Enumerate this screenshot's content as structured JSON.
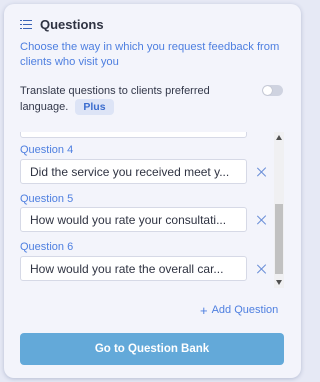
{
  "panel": {
    "title": "Questions",
    "subtitle": "Choose the way in which you request feedback from clients who visit you"
  },
  "translate": {
    "label_line1": "Translate questions to clients preferred",
    "label_line2": "language.",
    "badge": "Plus",
    "enabled": false
  },
  "questions": [
    {
      "label": "Question 4",
      "value": "Did the service you received meet y..."
    },
    {
      "label": "Question 5",
      "value": "How would you rate your consultati..."
    },
    {
      "label": "Question 6",
      "value": "How would you rate the overall car..."
    }
  ],
  "actions": {
    "add_question": "Add Question",
    "go_to_bank": "Go to Question Bank"
  },
  "colors": {
    "accent": "#4e7fe0",
    "button": "#63a9d9",
    "panel_bg": "#f3f4fb"
  },
  "icons": {
    "header": "list-icon",
    "remove": "close-icon",
    "add": "plus-icon"
  }
}
